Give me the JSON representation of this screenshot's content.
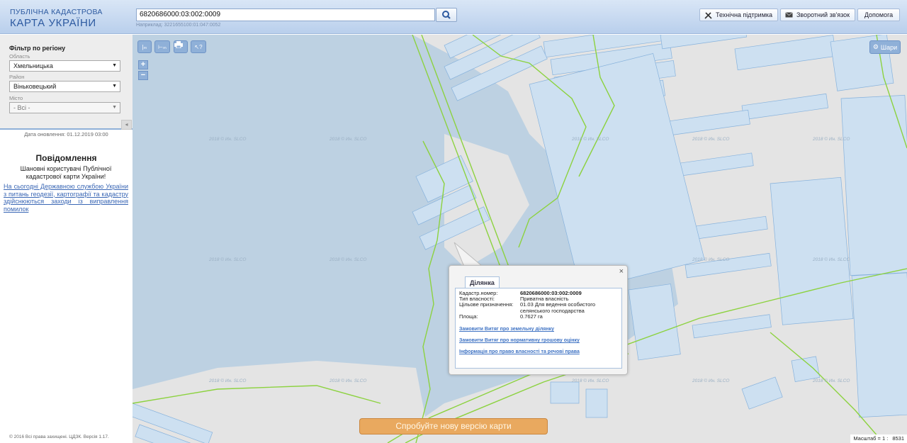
{
  "header": {
    "logo_line1": "ПУБЛІЧНА КАДАСТРОВА",
    "logo_line2": "КАРТА УКРАЇНИ",
    "search_value": "6820686000:03:002:0009",
    "search_hint": "Наприклад: 3221655100:01:047:0052",
    "buttons": {
      "support": "Технічна підтримка",
      "feedback": "Зворотний зв'язок",
      "help": "Допомога"
    }
  },
  "sidebar": {
    "filter_title": "Фільтр по регіону",
    "oblast_label": "Область",
    "oblast_value": "Хмельницька",
    "raion_label": "Район",
    "raion_value": "Віньковецький",
    "city_label": "Місто",
    "city_value": "- Всі -",
    "collapse_glyph": "◂",
    "updated": "Дата оновлення: 01.12.2019 03:00",
    "notice_title": "Повідомлення",
    "notice_text": "Шановні користувачі Публічної кадастрової карти України!",
    "notice_link": "На сьогодні Державною службою України з питань геодезії, картографії та кадастру здійснюються заходи із виправлення помилок",
    "copyright": "© 2016 Всі права захищені. ЦДЗК. Версія 1.17."
  },
  "map": {
    "layers_label": "Шари",
    "zoom_in": "+",
    "zoom_out": "−",
    "watermark": "2018 © Ин. SLCO",
    "new_version": "Спробуйте нову версію карти",
    "scale_label": "Масштаб = 1 : ",
    "scale_value": "8531",
    "colors": {
      "water": "#bdd1e2",
      "parcel": "#cde0f1",
      "boundary": "#87b2dc",
      "road": "#8cd23f",
      "land": "#e4e4e4"
    }
  },
  "popup": {
    "tab": "Ділянка",
    "close": "×",
    "fields": [
      {
        "key": "Кадастр.номер:",
        "value": "6820686000:03:002:0009",
        "bold": true
      },
      {
        "key": "Тип власності:",
        "value": "Приватна власність",
        "bold": false
      },
      {
        "key": "Цільове призначення:",
        "value": "01.03 Для ведення особистого селянського господарства",
        "bold": false
      },
      {
        "key": "Площа:",
        "value": "0.7627 га",
        "bold": false
      }
    ],
    "links": [
      "Замовити Витяг про земельну ділянку",
      "Замовити Витяг про нормативну грошову оцінку",
      "Інформація про право власності та речові права"
    ]
  }
}
